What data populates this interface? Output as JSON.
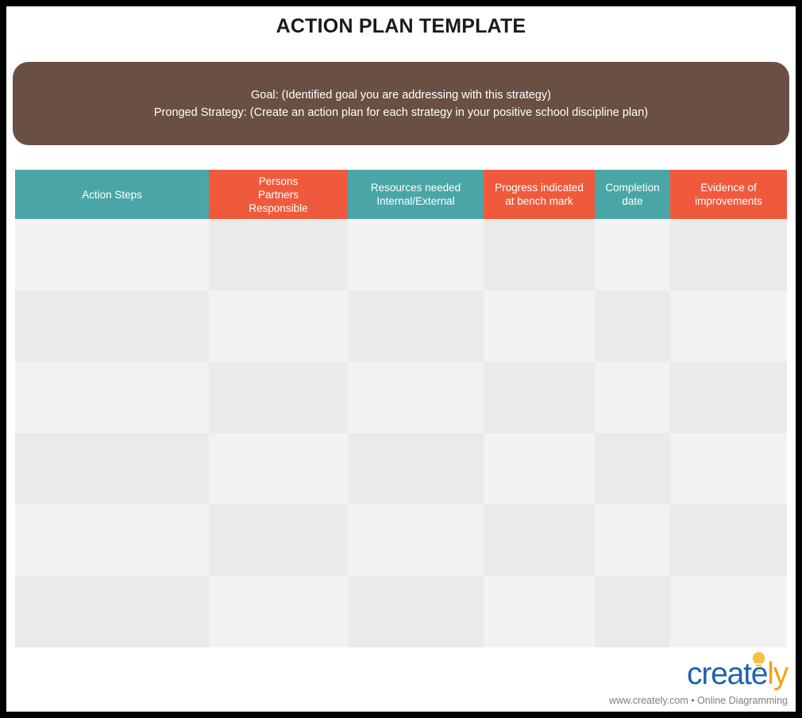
{
  "document": {
    "title": "ACTION PLAN TEMPLATE"
  },
  "banner": {
    "line1": "Goal:  (Identified goal you are addressing with this strategy)",
    "line2": "Pronged Strategy: (Create an action plan for each strategy in your positive school discipline plan)",
    "background_color": "#6A5044",
    "text_color": "#FFFFFF"
  },
  "table": {
    "header_colors": {
      "teal": "#4AA6A6",
      "orange": "#F05A3C"
    },
    "body_colors": {
      "light": "#F2F2F2",
      "dark": "#EAEAEA"
    },
    "columns": [
      {
        "label": "Action Steps",
        "color": "teal"
      },
      {
        "label": "Persons\nPartners\nResponsible",
        "color": "orange"
      },
      {
        "label": "Resources needed\nInternal/External",
        "color": "teal"
      },
      {
        "label": "Progress indicated\nat bench mark",
        "color": "orange"
      },
      {
        "label": "Completion\ndate",
        "color": "teal"
      },
      {
        "label": "Evidence of\nimprovements",
        "color": "orange"
      }
    ],
    "rows": [
      {
        "cells": [
          "",
          "",
          "",
          "",
          "",
          ""
        ]
      },
      {
        "cells": [
          "",
          "",
          "",
          "",
          "",
          ""
        ]
      },
      {
        "cells": [
          "",
          "",
          "",
          "",
          "",
          ""
        ]
      },
      {
        "cells": [
          "",
          "",
          "",
          "",
          "",
          ""
        ]
      },
      {
        "cells": [
          "",
          "",
          "",
          "",
          "",
          ""
        ]
      },
      {
        "cells": [
          "",
          "",
          "",
          "",
          "",
          ""
        ]
      }
    ]
  },
  "logo": {
    "name_part1": "create",
    "name_part2": "ly",
    "tagline": "www.creately.com • Online Diagramming",
    "color_blue": "#1F62AE",
    "color_orange": "#F2A118",
    "bulb_color": "#F5C242"
  }
}
